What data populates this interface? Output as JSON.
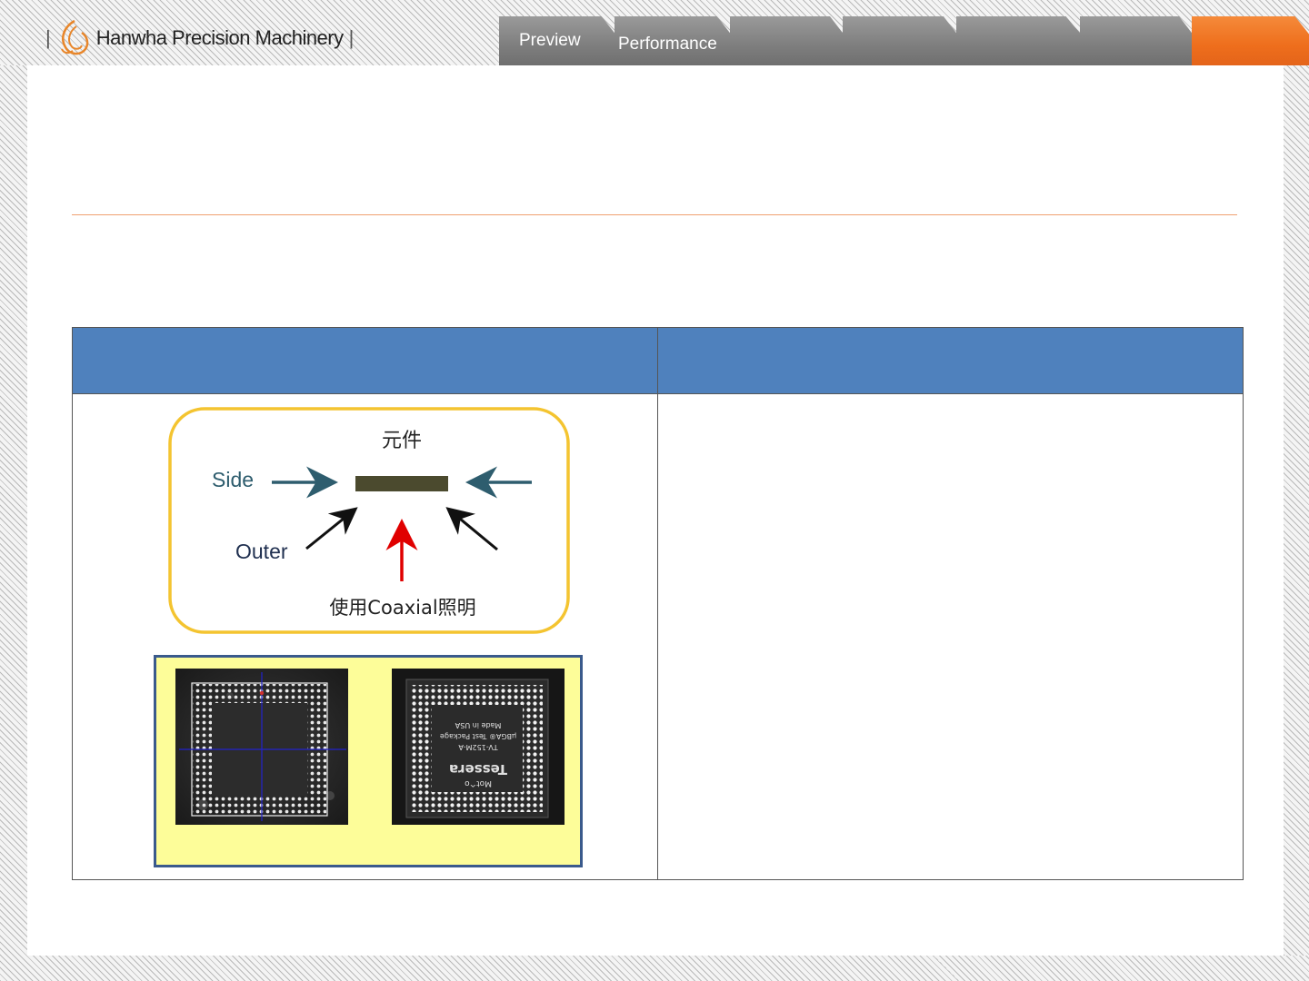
{
  "header": {
    "brand_name": "Hanwha Precision Machinery",
    "logo_bar_left": "|",
    "logo_bar_right": "|"
  },
  "tabs": [
    {
      "label": "Preview",
      "active": false
    },
    {
      "label": "Performance",
      "active": false
    },
    {
      "label": "",
      "active": false
    },
    {
      "label": "",
      "active": false
    },
    {
      "label": "",
      "active": false
    },
    {
      "label": "",
      "active": false
    },
    {
      "label": "",
      "active": true
    }
  ],
  "table": {
    "header_left": "",
    "header_right": "",
    "diagram": {
      "component_label": "元件",
      "side_label": "Side",
      "outer_label": "Outer",
      "coaxial_label": "使用Coaxial照明"
    },
    "photos": {
      "right_chip_lines": [
        "Mot^o",
        "Tessera",
        "TV-152M-A",
        "μBGA® Test Package",
        "Made in USA"
      ]
    }
  },
  "colors": {
    "accent_orange": "#ee6e1c",
    "table_header_blue": "#4f81bd",
    "diagram_border": "#f4c430",
    "side_arrow": "#2e5d6e",
    "coaxial_arrow": "#e00000",
    "component_fill": "#4b4a2e",
    "photo_frame_bg": "#fdfd99"
  }
}
